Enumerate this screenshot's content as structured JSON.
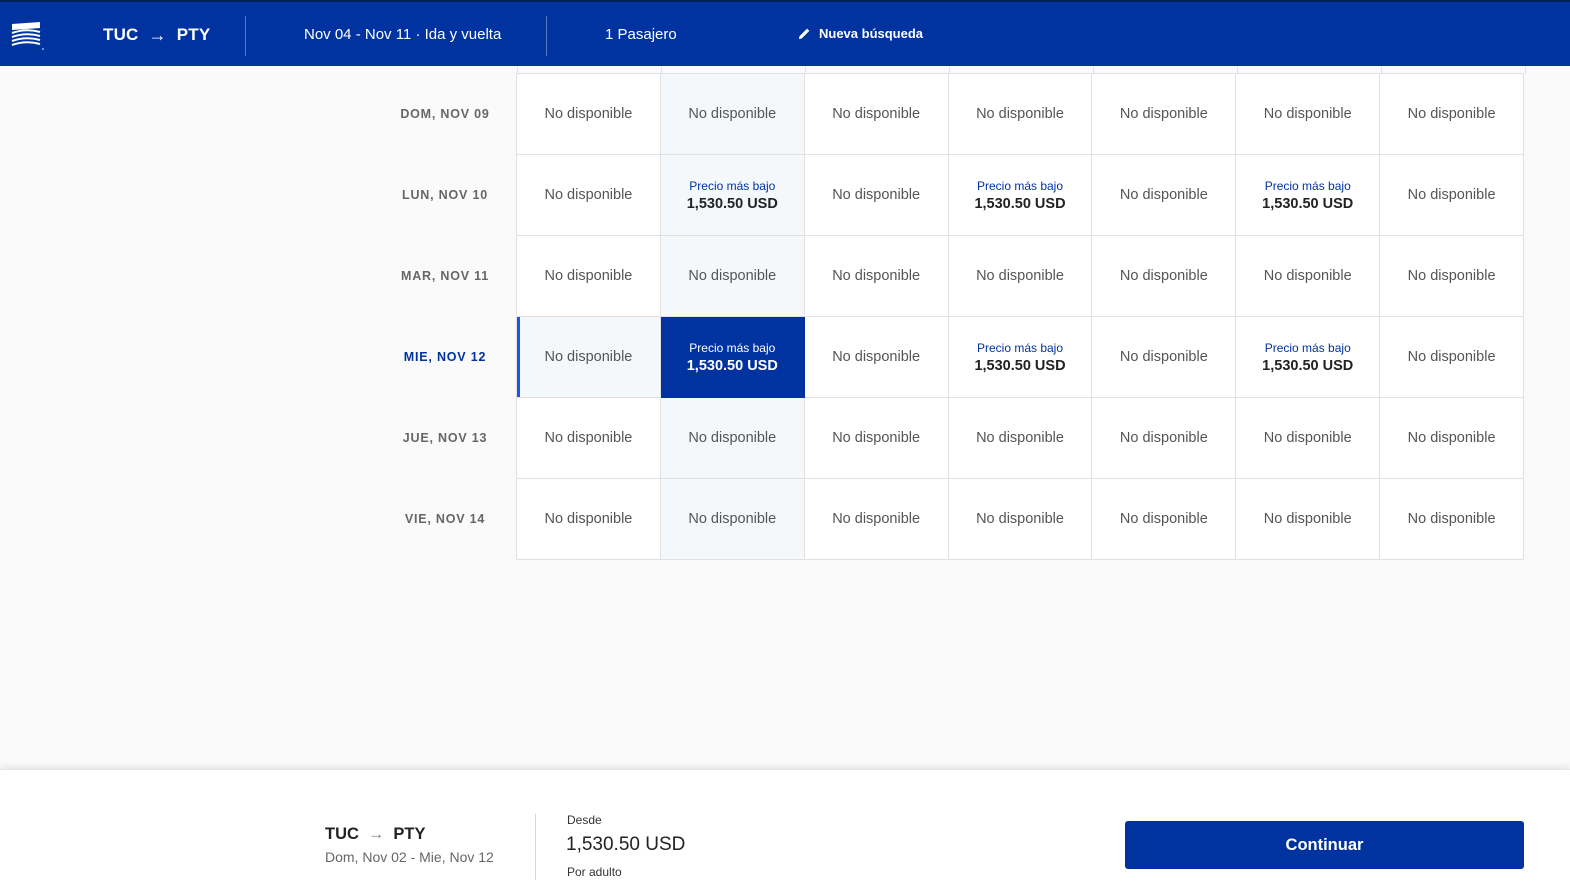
{
  "header": {
    "origin": "TUC",
    "destination": "PTY",
    "dates": "Nov 04 - Nov 11 · Ida y vuelta",
    "passengers": "1 Pasajero",
    "new_search": "Nueva búsqueda"
  },
  "grid": {
    "rows": [
      {
        "label": "DOM, NOV 09",
        "active": false,
        "cells": [
          {
            "type": "na",
            "text": "No disponible"
          },
          {
            "type": "na",
            "text": "No disponible"
          },
          {
            "type": "na",
            "text": "No disponible"
          },
          {
            "type": "na",
            "text": "No disponible"
          },
          {
            "type": "na",
            "text": "No disponible"
          },
          {
            "type": "na",
            "text": "No disponible"
          },
          {
            "type": "na",
            "text": "No disponible"
          }
        ]
      },
      {
        "label": "LUN, NOV 10",
        "active": false,
        "cells": [
          {
            "type": "na",
            "text": "No disponible"
          },
          {
            "type": "price",
            "label": "Precio más bajo",
            "price": "1,530.50 USD"
          },
          {
            "type": "na",
            "text": "No disponible"
          },
          {
            "type": "price",
            "label": "Precio más bajo",
            "price": "1,530.50 USD"
          },
          {
            "type": "na",
            "text": "No disponible"
          },
          {
            "type": "price",
            "label": "Precio más bajo",
            "price": "1,530.50 USD"
          },
          {
            "type": "na",
            "text": "No disponible"
          }
        ]
      },
      {
        "label": "MAR, NOV 11",
        "active": false,
        "cells": [
          {
            "type": "na",
            "text": "No disponible"
          },
          {
            "type": "na",
            "text": "No disponible"
          },
          {
            "type": "na",
            "text": "No disponible"
          },
          {
            "type": "na",
            "text": "No disponible"
          },
          {
            "type": "na",
            "text": "No disponible"
          },
          {
            "type": "na",
            "text": "No disponible"
          },
          {
            "type": "na",
            "text": "No disponible"
          }
        ]
      },
      {
        "label": "MIE, NOV 12",
        "active": true,
        "cells": [
          {
            "type": "na",
            "text": "No disponible"
          },
          {
            "type": "price",
            "label": "Precio más bajo",
            "price": "1,530.50 USD",
            "selected": true
          },
          {
            "type": "na",
            "text": "No disponible"
          },
          {
            "type": "price",
            "label": "Precio más bajo",
            "price": "1,530.50 USD"
          },
          {
            "type": "na",
            "text": "No disponible"
          },
          {
            "type": "price",
            "label": "Precio más bajo",
            "price": "1,530.50 USD"
          },
          {
            "type": "na",
            "text": "No disponible"
          }
        ]
      },
      {
        "label": "JUE, NOV 13",
        "active": false,
        "cells": [
          {
            "type": "na",
            "text": "No disponible"
          },
          {
            "type": "na",
            "text": "No disponible"
          },
          {
            "type": "na",
            "text": "No disponible"
          },
          {
            "type": "na",
            "text": "No disponible"
          },
          {
            "type": "na",
            "text": "No disponible"
          },
          {
            "type": "na",
            "text": "No disponible"
          },
          {
            "type": "na",
            "text": "No disponible"
          }
        ]
      },
      {
        "label": "VIE, NOV 14",
        "active": false,
        "cells": [
          {
            "type": "na",
            "text": "No disponible"
          },
          {
            "type": "na",
            "text": "No disponible"
          },
          {
            "type": "na",
            "text": "No disponible"
          },
          {
            "type": "na",
            "text": "No disponible"
          },
          {
            "type": "na",
            "text": "No disponible"
          },
          {
            "type": "na",
            "text": "No disponible"
          },
          {
            "type": "na",
            "text": "No disponible"
          }
        ]
      }
    ]
  },
  "footer": {
    "origin": "TUC",
    "destination": "PTY",
    "dates": "Dom, Nov 02 - Mie, Nov 12",
    "from_label": "Desde",
    "price": "1,530.50 USD",
    "per_label": "Por adulto",
    "continue_label": "Continuar"
  },
  "colors": {
    "brand": "#0033a0",
    "selected_bg": "#0033a0",
    "active_row_indicator": "#1a56e8"
  },
  "icons": {
    "logo": "airline-logo-icon",
    "arrow": "arrow-right-icon",
    "edit": "pencil-icon"
  }
}
